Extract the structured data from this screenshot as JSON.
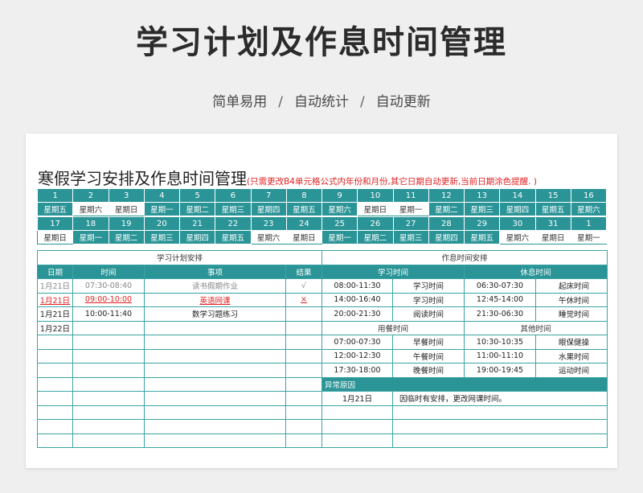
{
  "header": {
    "title": "学习计划及作息时间管理",
    "features": [
      "简单易用",
      "自动统计",
      "自动更新"
    ],
    "separator": "/"
  },
  "sheet": {
    "title": "寒假学习安排及作息时间管理",
    "note": "(只需更改B4单元格公式内年份和月份,其它日期自动更新,当前日期涂色提醒. )"
  },
  "calendar": {
    "row1": {
      "dates": [
        "1",
        "2",
        "3",
        "4",
        "5",
        "6",
        "7",
        "8",
        "9",
        "10",
        "11",
        "12",
        "13",
        "14",
        "15",
        "16"
      ],
      "weekdays": [
        "星期五",
        "星期六",
        "星期日",
        "星期一",
        "星期二",
        "星期三",
        "星期四",
        "星期五",
        "星期六",
        "星期日",
        "星期一",
        "星期二",
        "星期三",
        "星期四",
        "星期五",
        "星期六"
      ]
    },
    "row2": {
      "dates": [
        "17",
        "18",
        "19",
        "20",
        "21",
        "22",
        "23",
        "24",
        "25",
        "26",
        "27",
        "28",
        "29",
        "30",
        "31",
        "1"
      ],
      "weekdays": [
        "星期日",
        "星期一",
        "星期二",
        "星期三",
        "星期四",
        "星期五",
        "星期六",
        "星期日",
        "星期一",
        "星期二",
        "星期三",
        "星期四",
        "星期五",
        "星期六",
        "星期日",
        "星期一"
      ]
    }
  },
  "plan": {
    "section_title": "学习计划安排",
    "headers": {
      "date": "日期",
      "time": "时间",
      "item": "事项",
      "result": "结果"
    },
    "rows": [
      {
        "date": "1月21日",
        "time": "07:30-08:40",
        "item": "读书假期作业",
        "result": "√"
      },
      {
        "date": "1月21日",
        "time": "09:00-10:00",
        "item": "英语网课",
        "result": "×"
      },
      {
        "date": "1月21日",
        "time": "10:00-11:40",
        "item": "数学习题练习",
        "result": ""
      },
      {
        "date": "1月22日",
        "time": "",
        "item": "",
        "result": ""
      }
    ]
  },
  "schedule": {
    "section_title": "作息时间安排",
    "study_header": "学习时间",
    "rest_header": "休息时间",
    "study": [
      {
        "time": "08:00-11:30",
        "label": "学习时间"
      },
      {
        "time": "14:00-16:40",
        "label": "学习时间"
      },
      {
        "time": "20:00-21:30",
        "label": "阅读时间"
      }
    ],
    "rest": [
      {
        "time": "06:30-07:30",
        "label": "起床时间"
      },
      {
        "time": "12:45-14:00",
        "label": "午休时间"
      },
      {
        "time": "21:30-06:30",
        "label": "睡觉时间"
      }
    ],
    "meal_header": "用餐时间",
    "other_header": "其他时间",
    "meal": [
      {
        "time": "07:00-07:30",
        "label": "早餐时间"
      },
      {
        "time": "12:00-12:30",
        "label": "午餐时间"
      },
      {
        "time": "17:30-18:00",
        "label": "晚餐时间"
      }
    ],
    "other": [
      {
        "time": "10:30-10:35",
        "label": "眼保健操"
      },
      {
        "time": "11:00-11:10",
        "label": "水果时间"
      },
      {
        "time": "19:00-19:45",
        "label": "运动时间"
      }
    ],
    "exception_header": "异常原因",
    "exception": {
      "date": "1月21日",
      "reason": "因临时有安排，更改网课时间。"
    }
  },
  "colors": {
    "teal": "#2a9497",
    "red": "#e02020"
  }
}
